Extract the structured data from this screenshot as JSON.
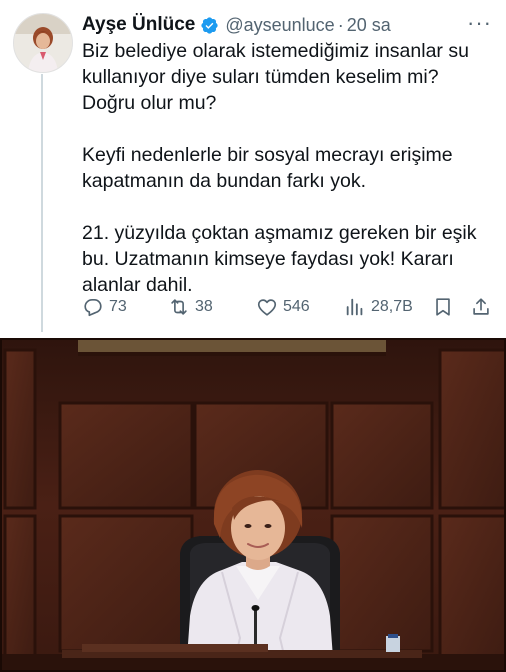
{
  "tweet": {
    "author_name": "Ayşe Ünlüce",
    "handle": "@ayseunluce",
    "separator": "·",
    "timestamp": "20 sa",
    "more_label": "···",
    "paragraphs": [
      "Biz belediye olarak istemediğimiz insanlar su kullanıyor diye suları tümden keselim mi? Doğru olur mu?",
      "Keyfi nedenlerle bir sosyal mecrayı erişime kapatmanın da bundan farkı yok.",
      "21. yüzyılda çoktan aşmamız gereken bir eşik bu. Uzatmanın kimseye faydası yok! Kararı alanlar dahil."
    ],
    "stats": {
      "replies": "73",
      "retweets": "38",
      "likes": "546",
      "views": "28,7B"
    },
    "icons": {
      "reply": "reply-icon",
      "retweet": "retweet-icon",
      "like": "heart-icon",
      "views": "views-icon",
      "bookmark": "bookmark-icon",
      "share": "share-icon",
      "verified": "verified-badge-icon",
      "more": "more-icon"
    },
    "colors": {
      "verified": "#1d9bf0",
      "text": "#0f1419",
      "secondary": "#536471"
    }
  },
  "photo": {
    "subject": "woman-seated-at-desk-photo"
  }
}
